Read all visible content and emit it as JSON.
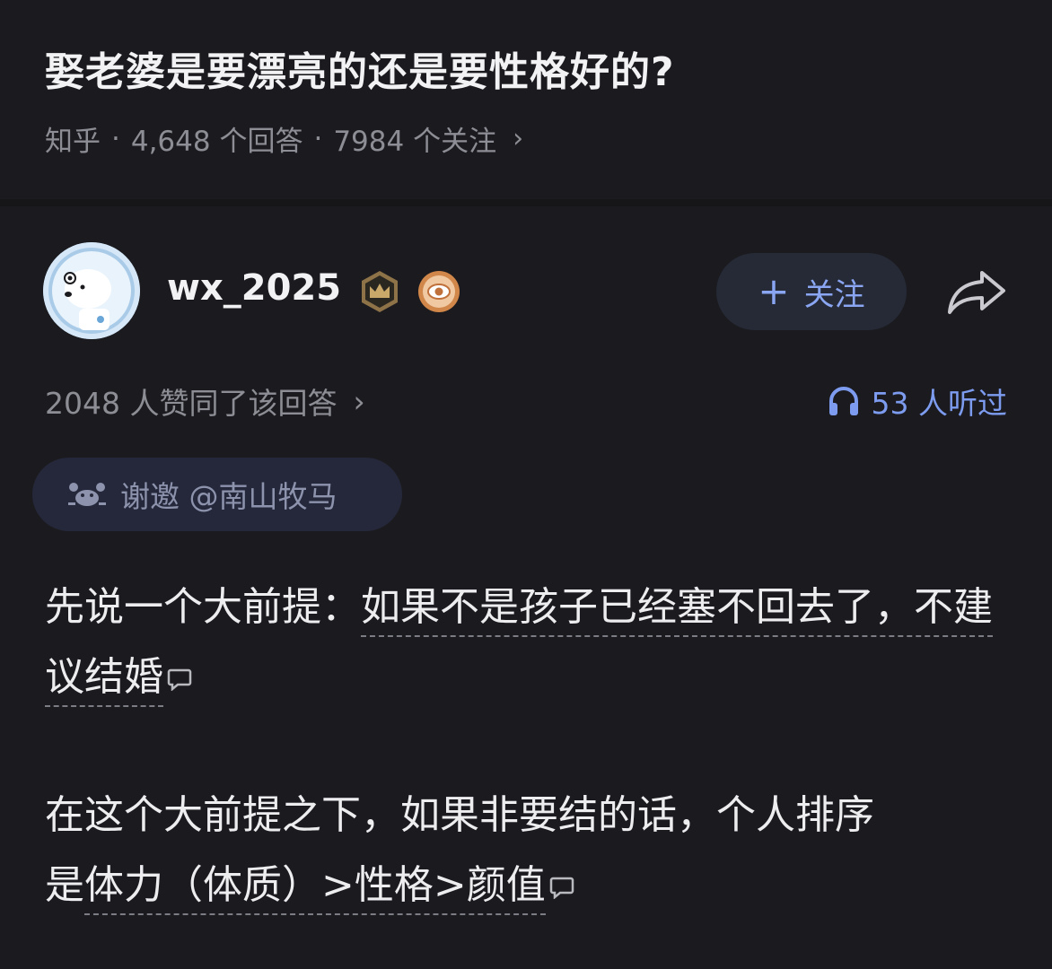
{
  "question": {
    "title": "娶老婆是要漂亮的还是要性格好的?",
    "source": "知乎",
    "separator": "·",
    "answer_count": "4,648 个回答",
    "follower_count": "7984 个关注",
    "chevron": "›"
  },
  "answer": {
    "author": "wx_2025",
    "badges": [
      "crown-badge-icon",
      "eye-badge-icon"
    ],
    "follow_label": "关注",
    "follow_plus": "+",
    "share_icon": "share-icon",
    "upvote_text": "2048 人赞同了该回答",
    "upvote_chevron": "›",
    "listen_text": "53 人听过",
    "invite_text": "谢邀 @南山牧马",
    "paragraph1_lead": "先说一个大前提：",
    "paragraph1_highlight": "如果不是孩子已经塞不回去了，不建议结婚",
    "paragraph2_lead": "在这个大前提之下，如果非要结的话，个人排序",
    "paragraph2_highlight_pre": "是",
    "paragraph2_highlight": "体力（体质）>性格>颜值"
  },
  "colors": {
    "background": "#1b1b1f",
    "accent_blue": "#7d9cf0",
    "muted_text": "#8d8e95",
    "primary_text": "#f2f2f4"
  }
}
